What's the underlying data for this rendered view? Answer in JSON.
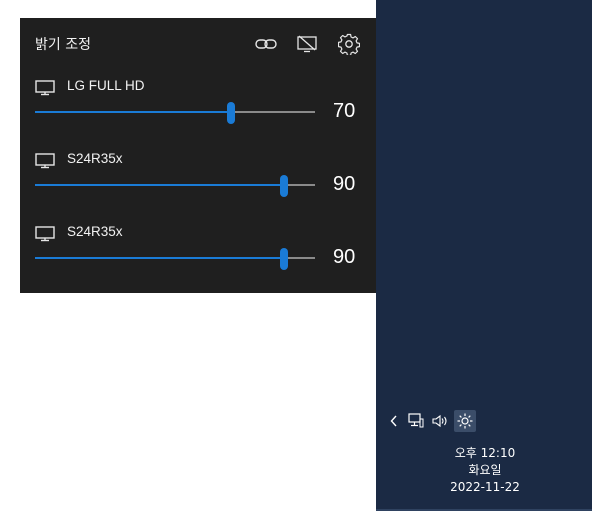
{
  "panel": {
    "title": "밝기 조정",
    "header_icons": [
      "link-icon",
      "display-off-icon",
      "gear-icon"
    ]
  },
  "monitors": [
    {
      "name": "LG FULL HD",
      "brightness": 70,
      "slider_fraction": 0.7
    },
    {
      "name": "S24R35x",
      "brightness": 90,
      "slider_fraction": 0.89
    },
    {
      "name": "S24R35x",
      "brightness": 90,
      "slider_fraction": 0.89
    }
  ],
  "taskbar": {
    "tray_icons": [
      "chevron-left-icon",
      "network-icon",
      "volume-icon",
      "brightness-icon"
    ],
    "clock": {
      "time": "오후 12:10",
      "day": "화요일",
      "date": "2022-11-22"
    }
  },
  "colors": {
    "accent": "#1a7bd6",
    "panel_bg": "#1f1f1f",
    "taskbar_bg": "#1b2a44"
  }
}
